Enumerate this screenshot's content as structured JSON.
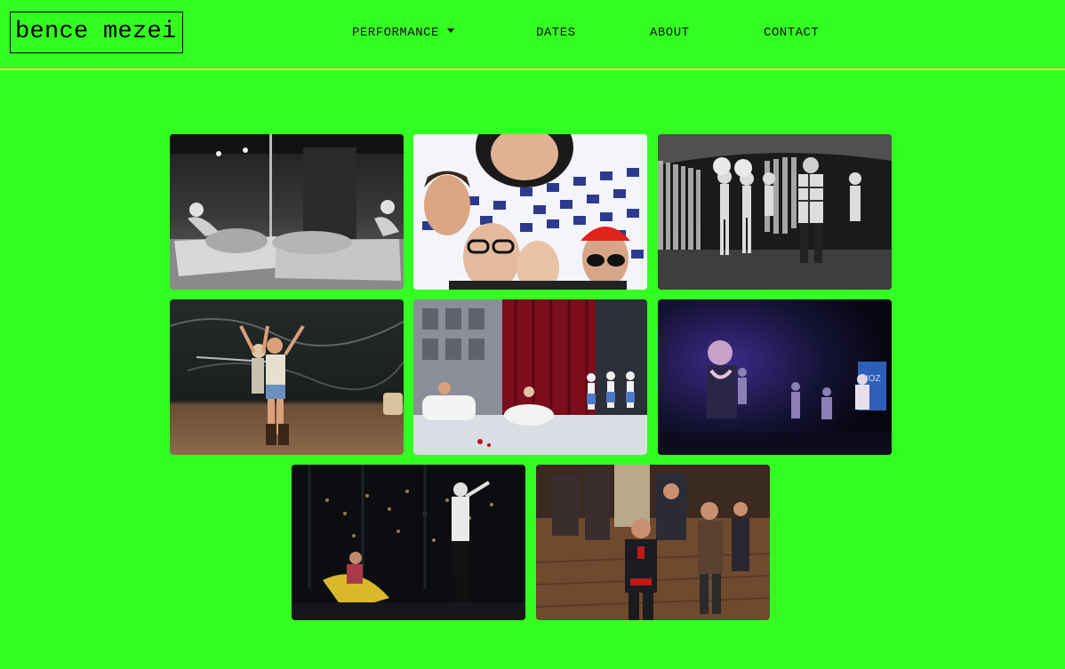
{
  "header": {
    "logo_text": "bence mezei",
    "nav": [
      {
        "label": "PERFORMANCE",
        "has_dropdown": true
      },
      {
        "label": "DATES"
      },
      {
        "label": "ABOUT"
      },
      {
        "label": "CONTACT"
      }
    ]
  },
  "colors": {
    "background": "#33ff22",
    "header_rule": "#e8f03a",
    "text": "#111111"
  },
  "gallery": {
    "photos": [
      {
        "id": "photo-1",
        "description": "black and white stage scene with performers on beds"
      },
      {
        "id": "photo-2",
        "description": "group selfie of four men on checkered backdrop"
      },
      {
        "id": "photo-3",
        "description": "black and white cabaret stage with dancers and curtain"
      },
      {
        "id": "photo-4",
        "description": "performers in cowboy costume on dark marble stage"
      },
      {
        "id": "photo-5",
        "description": "opera scene with bathtub, red curtain and dancers"
      },
      {
        "id": "photo-6",
        "description": "dark blue lit stage with performers"
      },
      {
        "id": "photo-7",
        "description": "dark stage with lit trees and dancers"
      },
      {
        "id": "photo-8",
        "description": "performers in mariachi and western costumes on wooden floor"
      }
    ]
  }
}
